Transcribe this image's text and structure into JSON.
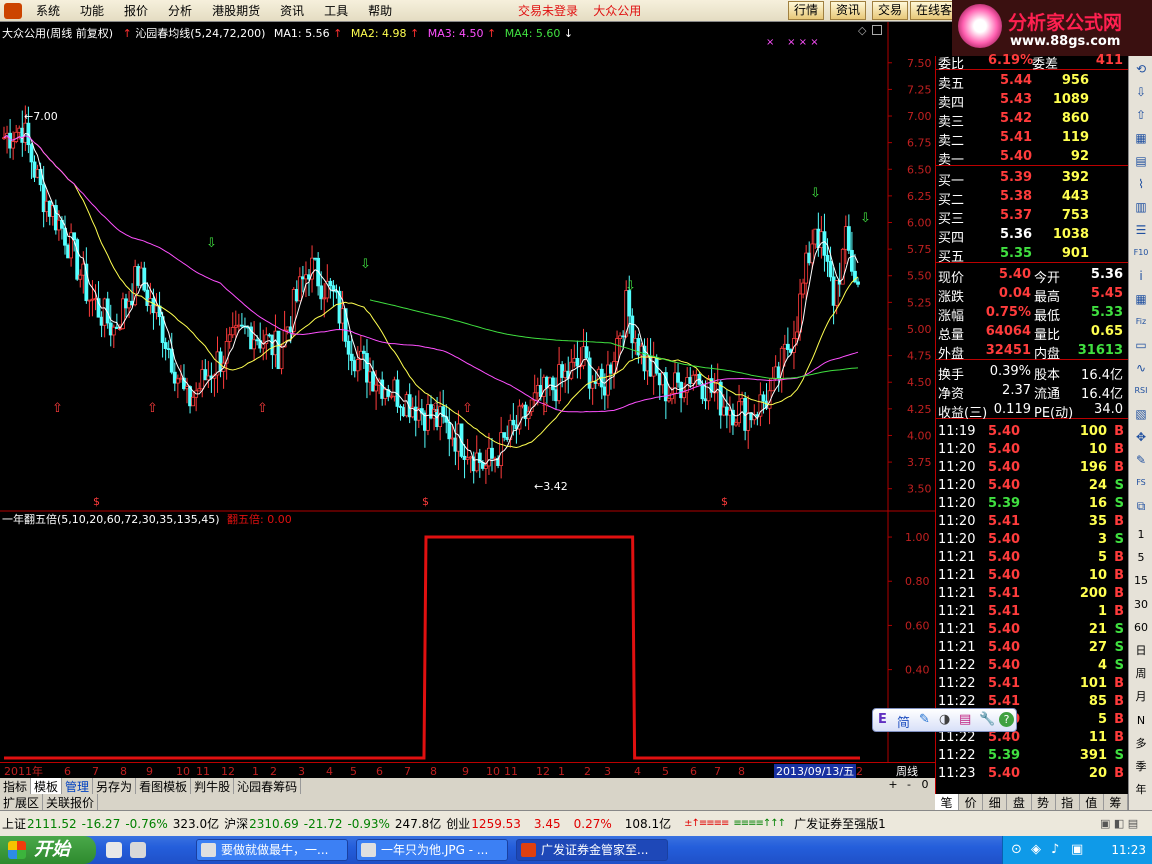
{
  "menu": {
    "items": [
      "系统",
      "功能",
      "报价",
      "分析",
      "港股期货",
      "资讯",
      "工具",
      "帮助"
    ],
    "center_links": [
      "交易未登录",
      "大众公用"
    ],
    "right_buttons": [
      "行情",
      "资讯",
      "交易",
      "在线客"
    ],
    "brand_name": "分析家公式网",
    "brand_url": "www.88gs.com"
  },
  "main_chart": {
    "title": "大众公用(周线 前复权)",
    "indicator": "沁园春均线(5,24,72,200)",
    "ma1": "MA1: 5.56",
    "ma2": "MA2: 4.98",
    "ma3": "MA3: 4.50",
    "ma4": "MA4: 5.60",
    "price_axis": [
      "7.50",
      "7.25",
      "7.00",
      "6.75",
      "6.50",
      "6.25",
      "6.00",
      "5.75",
      "5.50",
      "5.25",
      "5.00",
      "4.75",
      "4.50",
      "4.25",
      "4.00",
      "3.75",
      "3.50"
    ],
    "high_label": "7.00",
    "low_label": "3.42",
    "s_marks": [
      "$",
      "$",
      "$"
    ],
    "x_marks": "×    × × ×"
  },
  "sub_chart": {
    "title": "一年翻五倍(5,10,20,60,72,30,35,135,45)",
    "value": "翻五倍: 0.00",
    "axis": [
      "1.00",
      "0.80",
      "0.60",
      "0.40",
      "0.20"
    ]
  },
  "chart_data": [
    {
      "type": "line",
      "title": "一年翻五倍",
      "series": [
        {
          "name": "翻五倍",
          "values": [
            0,
            0,
            0,
            0,
            0,
            0,
            0,
            0,
            0,
            0,
            0,
            0,
            0,
            0,
            0,
            0,
            0,
            0,
            0,
            0,
            0,
            0,
            0,
            0,
            0,
            0,
            0,
            0,
            0,
            0,
            0,
            0,
            0,
            0,
            0,
            0,
            0,
            0,
            0,
            0,
            0,
            0,
            0,
            0,
            0,
            0,
            0,
            0,
            0,
            0,
            0,
            0,
            0,
            0,
            0,
            0,
            0,
            0,
            0,
            0,
            0,
            0,
            0,
            0,
            0,
            0,
            0,
            0,
            0,
            0,
            0,
            0,
            0,
            0,
            0,
            0,
            0,
            0,
            0,
            1,
            1,
            1,
            1,
            1,
            1,
            1,
            1,
            1,
            1,
            1,
            1,
            1,
            1,
            1,
            1,
            1,
            1,
            1,
            1,
            1,
            1,
            1,
            1,
            1,
            1,
            1,
            1,
            1,
            1,
            1,
            1,
            1,
            1,
            1,
            1,
            1,
            1,
            1,
            0,
            0,
            0,
            0,
            0,
            0,
            0,
            0,
            0,
            0,
            0,
            0,
            0,
            0,
            0,
            0,
            0,
            0,
            0,
            0,
            0,
            0,
            0,
            0,
            0,
            0,
            0,
            0,
            0,
            0,
            0,
            0,
            0,
            0,
            0,
            0,
            0,
            0,
            0,
            0,
            0,
            0,
            0
          ]
        }
      ],
      "ylim": [
        0,
        1.05
      ]
    }
  ],
  "time_axis": [
    "2011年",
    "6",
    "7",
    "8",
    "9",
    "10",
    "11",
    "12",
    "1",
    "2",
    "3",
    "4",
    "5",
    "6",
    "7",
    "8",
    "9",
    "10",
    "11",
    "12",
    "1",
    "2",
    "3",
    "4",
    "5",
    "6",
    "7",
    "8",
    "2013/09/13/五",
    "2"
  ],
  "time_axis_right": "周线",
  "tabs": [
    "指标",
    "模板",
    "管理",
    "另存为",
    "看图模板",
    "判牛股",
    "沁园春筹码"
  ],
  "tabs2": [
    "扩展区",
    "关联报价"
  ],
  "tab_controls": [
    "+",
    "-",
    "0"
  ],
  "quote": {
    "weibi": {
      "label": "委比",
      "value": "6.19%",
      "label2": "委差",
      "value2": "411"
    },
    "sell": [
      {
        "label": "卖五",
        "price": "5.44",
        "vol": "956"
      },
      {
        "label": "卖四",
        "price": "5.43",
        "vol": "1089"
      },
      {
        "label": "卖三",
        "price": "5.42",
        "vol": "860"
      },
      {
        "label": "卖二",
        "price": "5.41",
        "vol": "119"
      },
      {
        "label": "卖一",
        "price": "5.40",
        "vol": "92"
      }
    ],
    "buy": [
      {
        "label": "买一",
        "price": "5.39",
        "vol": "392"
      },
      {
        "label": "买二",
        "price": "5.38",
        "vol": "443"
      },
      {
        "label": "买三",
        "price": "5.37",
        "vol": "753"
      },
      {
        "label": "买四",
        "price": "5.36",
        "vol": "1038"
      },
      {
        "label": "买五",
        "price": "5.35",
        "vol": "901"
      }
    ],
    "stats": [
      {
        "l1": "现价",
        "v1": "5.40",
        "l2": "今开",
        "v2": "5.36"
      },
      {
        "l1": "涨跌",
        "v1": "0.04",
        "l2": "最高",
        "v2": "5.45"
      },
      {
        "l1": "涨幅",
        "v1": "0.75%",
        "l2": "最低",
        "v2": "5.33"
      },
      {
        "l1": "总量",
        "v1": "64064",
        "l2": "量比",
        "v2": "0.65"
      },
      {
        "l1": "外盘",
        "v1": "32451",
        "l2": "内盘",
        "v2": "31613"
      }
    ],
    "stats2": [
      {
        "l1": "换手",
        "v1": "0.39%",
        "l2": "股本",
        "v2": "16.4亿"
      },
      {
        "l1": "净资",
        "v1": "2.37",
        "l2": "流通",
        "v2": "16.4亿"
      },
      {
        "l1": "收益(三)",
        "v1": "0.119",
        "l2": "PE(动)",
        "v2": "34.0"
      }
    ]
  },
  "ticks": [
    {
      "t": "11:19",
      "p": "5.40",
      "v": "100",
      "s": "B"
    },
    {
      "t": "11:20",
      "p": "5.40",
      "v": "10",
      "s": "B"
    },
    {
      "t": "11:20",
      "p": "5.40",
      "v": "196",
      "s": "B"
    },
    {
      "t": "11:20",
      "p": "5.40",
      "v": "24",
      "s": "S"
    },
    {
      "t": "11:20",
      "p": "5.39",
      "v": "16",
      "s": "S"
    },
    {
      "t": "11:20",
      "p": "5.41",
      "v": "35",
      "s": "B"
    },
    {
      "t": "11:20",
      "p": "5.40",
      "v": "3",
      "s": "S"
    },
    {
      "t": "11:21",
      "p": "5.40",
      "v": "5",
      "s": "B"
    },
    {
      "t": "11:21",
      "p": "5.40",
      "v": "10",
      "s": "B"
    },
    {
      "t": "11:21",
      "p": "5.41",
      "v": "200",
      "s": "B"
    },
    {
      "t": "11:21",
      "p": "5.41",
      "v": "1",
      "s": "B"
    },
    {
      "t": "11:21",
      "p": "5.40",
      "v": "21",
      "s": "S"
    },
    {
      "t": "11:21",
      "p": "5.40",
      "v": "27",
      "s": "S"
    },
    {
      "t": "11:22",
      "p": "5.40",
      "v": "4",
      "s": "S"
    },
    {
      "t": "11:22",
      "p": "5.41",
      "v": "101",
      "s": "B"
    },
    {
      "t": "11:22",
      "p": "5.41",
      "v": "85",
      "s": "B"
    },
    {
      "t": "11:22",
      "p": "5.40",
      "v": "5",
      "s": "B"
    },
    {
      "t": "11:22",
      "p": "5.40",
      "v": "11",
      "s": "B"
    },
    {
      "t": "11:22",
      "p": "5.39",
      "v": "391",
      "s": "S"
    },
    {
      "t": "11:23",
      "p": "5.40",
      "v": "20",
      "s": "B"
    }
  ],
  "right_tabs": [
    "笔",
    "价",
    "细",
    "盘",
    "势",
    "指",
    "值",
    "筹"
  ],
  "side_toolbar": [
    "1",
    "5",
    "15",
    "30",
    "60",
    "日",
    "周",
    "月",
    "N",
    "多",
    "季",
    "年"
  ],
  "status": {
    "sh_label": "上证",
    "sh_value": "2111.52",
    "sh_chg": "-16.27",
    "sh_pct": "-0.76%",
    "sh_amt": "323.0亿",
    "hs_label": "沪深",
    "hs_value": "2310.69",
    "hs_chg": "-21.72",
    "hs_pct": "-0.93%",
    "hs_amt": "247.8亿",
    "cy_label": "创业",
    "cy_value": "1259.53",
    "cy_chg": "3.45",
    "cy_pct": "0.27%",
    "cy_amt": "108.1亿",
    "broker": "广发证券至强版1"
  },
  "taskbar": {
    "start": "开始",
    "items": [
      "要做就做最牛，一...",
      "一年只为他.JPG - ...",
      "广发证券金管家至..."
    ],
    "clock": "11:23"
  },
  "float_toolbar": [
    "E",
    "简",
    "✎",
    "◑",
    "▤",
    "🔧",
    "?"
  ],
  "colors": {
    "up": "#ff3c3c",
    "down": "#54ffff",
    "ma1": "#ffffff",
    "ma2": "#ffff50",
    "ma3": "#ff50ff",
    "ma4": "#40e040",
    "signal": "#e01010",
    "grid_border": "#b00000"
  }
}
